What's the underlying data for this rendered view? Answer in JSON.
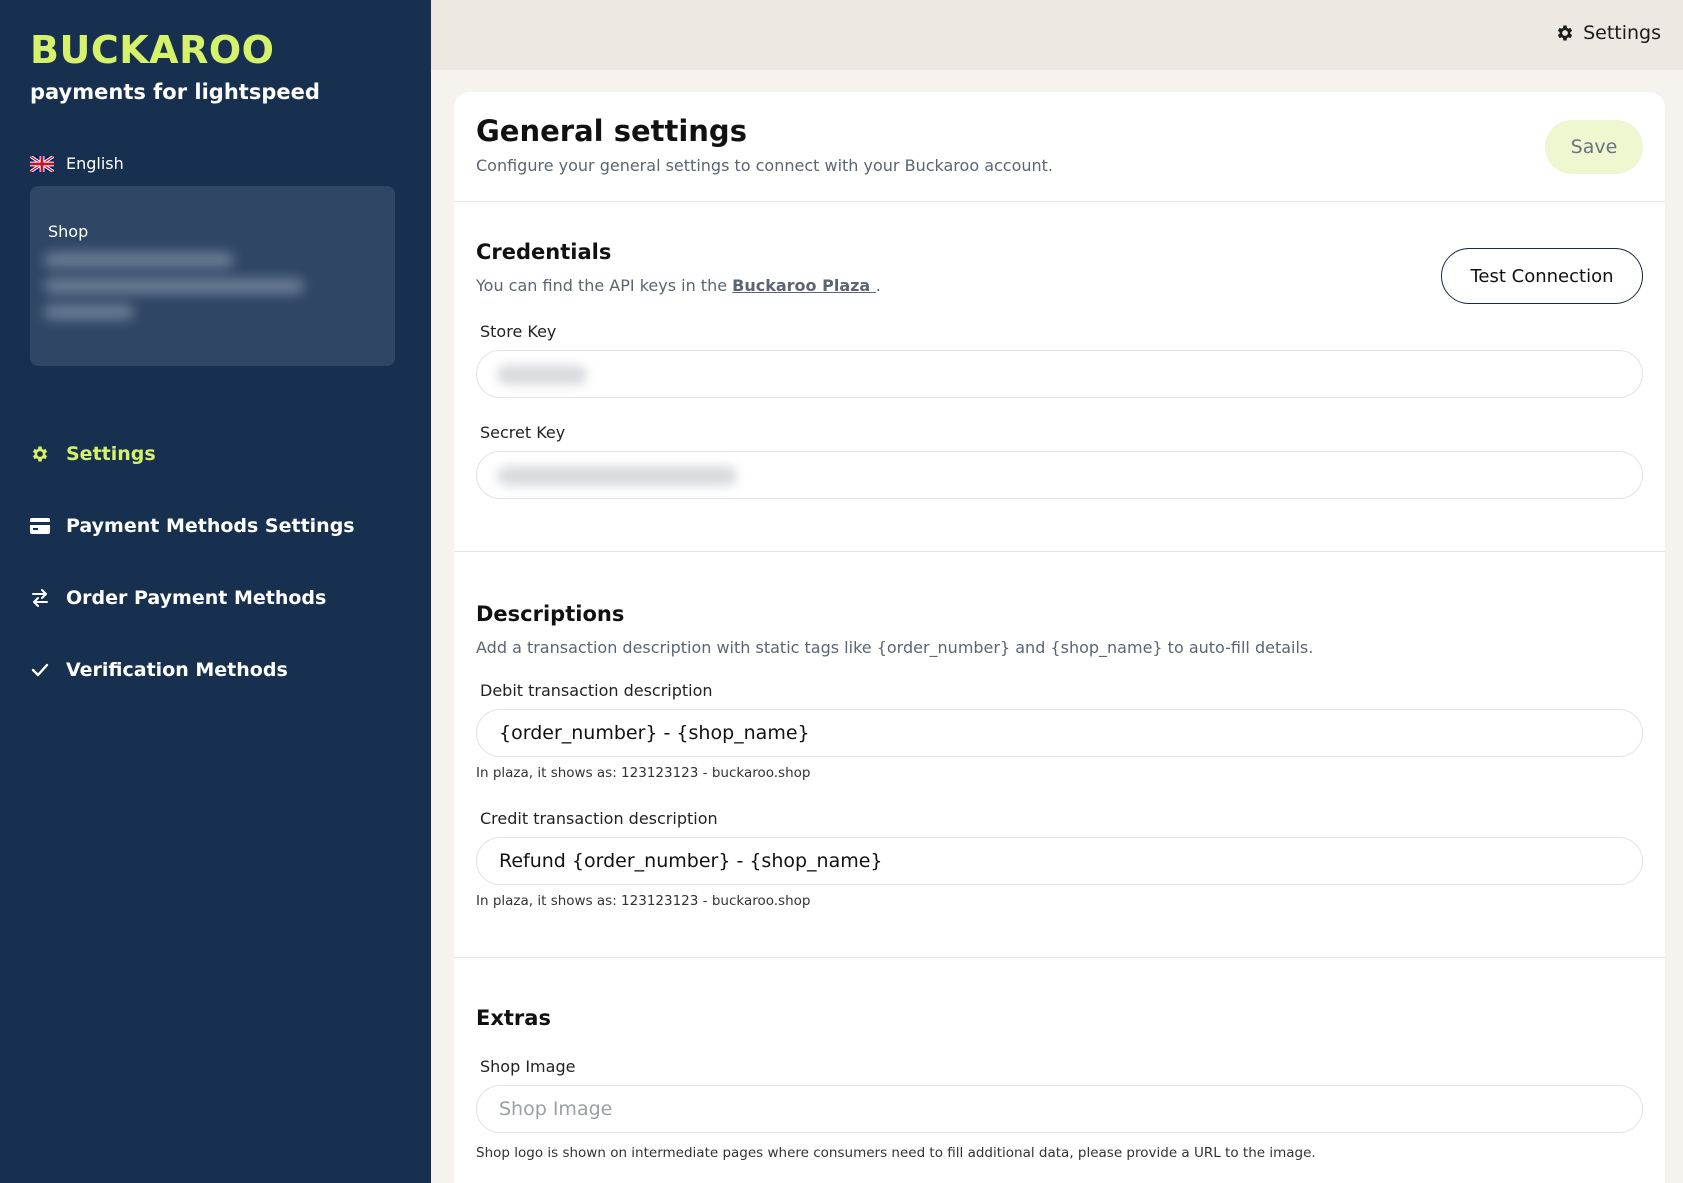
{
  "brand": {
    "logo_text": "BUCKAROO",
    "tagline": "payments for lightspeed",
    "accent_color": "#d6f26b",
    "sidebar_color": "#18304f"
  },
  "language": {
    "label": "English",
    "icon": "uk-flag-icon"
  },
  "shop_card": {
    "label": "Shop"
  },
  "nav": [
    {
      "label": "Settings",
      "icon": "gear-icon",
      "active": true
    },
    {
      "label": "Payment Methods Settings",
      "icon": "credit-card-icon",
      "active": false
    },
    {
      "label": "Order Payment Methods",
      "icon": "swap-arrows-icon",
      "active": false
    },
    {
      "label": "Verification Methods",
      "icon": "checkmark-icon",
      "active": false
    }
  ],
  "topbar": {
    "settings_label": "Settings",
    "settings_icon": "gear-icon"
  },
  "general": {
    "title": "General settings",
    "subtitle": "Configure your general settings to connect with your Buckaroo account.",
    "save_label": "Save"
  },
  "credentials": {
    "title": "Credentials",
    "subtitle_prefix": "You can find the API keys in the",
    "link_text": "Buckaroo Plaza ",
    "subtitle_suffix": ".",
    "test_button": "Test Connection",
    "store_key_label": "Store Key",
    "secret_key_label": "Secret Key"
  },
  "descriptions": {
    "title": "Descriptions",
    "subtitle": "Add a transaction description with static tags like {order_number} and {shop_name} to auto-fill details.",
    "debit_label": "Debit transaction description",
    "debit_value": "{order_number} - {shop_name}",
    "debit_hint": "In plaza, it shows as: 123123123 - buckaroo.shop",
    "credit_label": "Credit transaction description",
    "credit_value": "Refund {order_number} - {shop_name}",
    "credit_hint": "In plaza, it shows as: 123123123 - buckaroo.shop"
  },
  "extras": {
    "title": "Extras",
    "shop_image_label": "Shop Image",
    "shop_image_placeholder": "Shop Image",
    "shop_image_hint": "Shop logo is shown on intermediate pages where consumers need to fill additional data, please provide a URL to the image."
  }
}
